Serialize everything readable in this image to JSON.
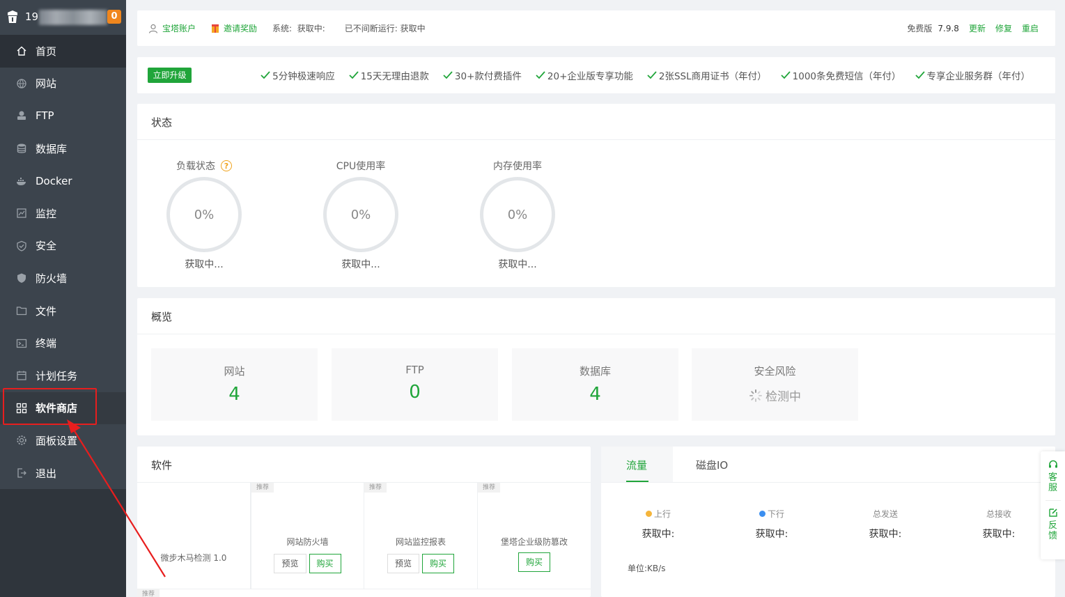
{
  "sidebar": {
    "user_prefix": "19",
    "badge": "0",
    "items": [
      {
        "label": "首页",
        "icon": "home-icon"
      },
      {
        "label": "网站",
        "icon": "globe-icon"
      },
      {
        "label": "FTP",
        "icon": "ftp-icon"
      },
      {
        "label": "数据库",
        "icon": "database-icon"
      },
      {
        "label": "Docker",
        "icon": "docker-icon"
      },
      {
        "label": "监控",
        "icon": "monitor-icon"
      },
      {
        "label": "安全",
        "icon": "shield-check-icon"
      },
      {
        "label": "防火墙",
        "icon": "firewall-icon"
      },
      {
        "label": "文件",
        "icon": "folder-icon"
      },
      {
        "label": "终端",
        "icon": "terminal-icon"
      },
      {
        "label": "计划任务",
        "icon": "calendar-icon"
      },
      {
        "label": "软件商店",
        "icon": "app-grid-icon"
      },
      {
        "label": "面板设置",
        "icon": "gear-icon"
      },
      {
        "label": "退出",
        "icon": "logout-icon"
      }
    ]
  },
  "topbar": {
    "account": "宝塔账户",
    "invite": "邀请奖励",
    "system_label": "系统:",
    "system_value": "获取中:",
    "uptime_label": "已不间断运行:",
    "uptime_value": "获取中",
    "edition": "免费版",
    "version": "7.9.8",
    "update": "更新",
    "repair": "修复",
    "restart": "重启"
  },
  "upgrade": {
    "button": "立即升级",
    "features": [
      "5分钟极速响应",
      "15天无理由退款",
      "30+款付费插件",
      "20+企业版专享功能",
      "2张SSL商用证书（年付）",
      "1000条免费短信（年付）",
      "专享企业服务群（年付）"
    ]
  },
  "status": {
    "title": "状态",
    "gauges": [
      {
        "label": "负载状态",
        "value": "0%",
        "sub": "获取中..."
      },
      {
        "label": "CPU使用率",
        "value": "0%",
        "sub": "获取中..."
      },
      {
        "label": "内存使用率",
        "value": "0%",
        "sub": "获取中..."
      }
    ]
  },
  "overview": {
    "title": "概览",
    "boxes": [
      {
        "label": "网站",
        "value": "4"
      },
      {
        "label": "FTP",
        "value": "0"
      },
      {
        "label": "数据库",
        "value": "4"
      },
      {
        "label": "安全风险",
        "value": "检测中"
      }
    ]
  },
  "software": {
    "title": "软件",
    "tag": "推荐",
    "items": [
      {
        "name": "微步木马检测 1.0"
      },
      {
        "name": "网站防火墙",
        "preview": "预览",
        "buy": "购买"
      },
      {
        "name": "网站监控报表",
        "preview": "预览",
        "buy": "购买"
      },
      {
        "name": "堡塔企业级防篡改",
        "buy": "购买"
      }
    ]
  },
  "traffic": {
    "tab_active": "流量",
    "tab_disk": "磁盘IO",
    "cols": [
      {
        "label": "上行",
        "value": "获取中:",
        "dot": "#f5b53b"
      },
      {
        "label": "下行",
        "value": "获取中:",
        "dot": "#3c8ff0"
      },
      {
        "label": "总发送",
        "value": "获取中:"
      },
      {
        "label": "总接收",
        "value": "获取中:"
      }
    ],
    "unit": "单位:KB/s"
  },
  "float": {
    "service": [
      "客",
      "服"
    ],
    "feedback": [
      "反",
      "馈"
    ]
  },
  "colors": {
    "accent": "#20a53a",
    "sidebar": "#3c444d",
    "annotation_red": "#e81e1e"
  }
}
